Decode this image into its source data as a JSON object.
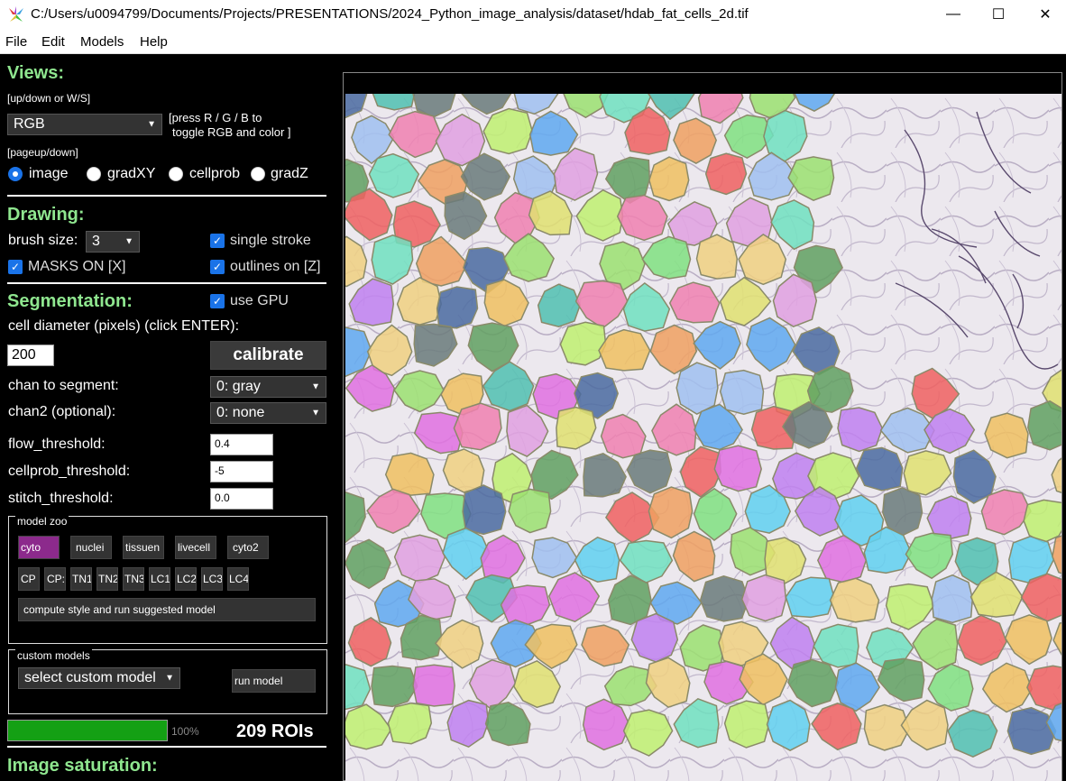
{
  "window": {
    "title": "C:/Users/u0094799/Documents/Projects/PRESENTATIONS/2024_Python_image_analysis/dataset/hdab_fat_cells_2d.tif",
    "minimize_glyph": "—",
    "maximize_glyph": "☐",
    "close_glyph": "✕"
  },
  "menu": [
    "File",
    "Edit",
    "Models",
    "Help"
  ],
  "views": {
    "header": "Views:",
    "hint_updown": "[up/down or W/S]",
    "color_mode": "RGB",
    "rgb_hint_line1": "[press R / G / B to",
    "rgb_hint_line2": "toggle RGB and color ]",
    "hint_pageupdown": "[pageup/down]",
    "radios": [
      {
        "label": "image",
        "selected": true
      },
      {
        "label": "gradXY",
        "selected": false
      },
      {
        "label": "cellprob",
        "selected": false
      },
      {
        "label": "gradZ",
        "selected": false
      }
    ]
  },
  "drawing": {
    "header": "Drawing:",
    "brush_label": "brush size:",
    "brush_value": "3",
    "single_stroke": "single stroke",
    "masks_on": "MASKS ON [X]",
    "outlines_on": "outlines on [Z]"
  },
  "segmentation": {
    "header": "Segmentation:",
    "use_gpu": "use GPU",
    "diameter_label": "cell diameter (pixels) (click ENTER):",
    "diameter_value": "200",
    "calibrate": "calibrate",
    "chan_label": "chan to segment:",
    "chan_value": "0: gray",
    "chan2_label": "chan2 (optional):",
    "chan2_value": "0: none",
    "flow_label": "flow_threshold:",
    "flow_value": "0.4",
    "cellprob_label": "cellprob_threshold:",
    "cellprob_value": "-5",
    "stitch_label": "stitch_threshold:",
    "stitch_value": "0.0"
  },
  "model_zoo": {
    "title": "model zoo",
    "models": [
      "cyto",
      "nuclei",
      "tissuen",
      "livecell",
      "cyto2"
    ],
    "active_model": "cyto",
    "small_models": [
      "CP",
      "CP:",
      "TN1",
      "TN2",
      "TN3",
      "LC1",
      "LC2",
      "LC3",
      "LC4"
    ],
    "suggest_button": "compute style and run suggested model"
  },
  "custom_models": {
    "title": "custom models",
    "select_label": "select custom model",
    "run_button": "run model"
  },
  "progress": {
    "fraction": 1.0,
    "text": "100%",
    "roi_count": "209 ROIs"
  },
  "saturation": {
    "header": "Image saturation:"
  },
  "colors": {
    "header_green": "#8fe68f",
    "accent_blue": "#1a73e8",
    "active_model": "#8c2a8c",
    "progress_green": "#14a014"
  }
}
